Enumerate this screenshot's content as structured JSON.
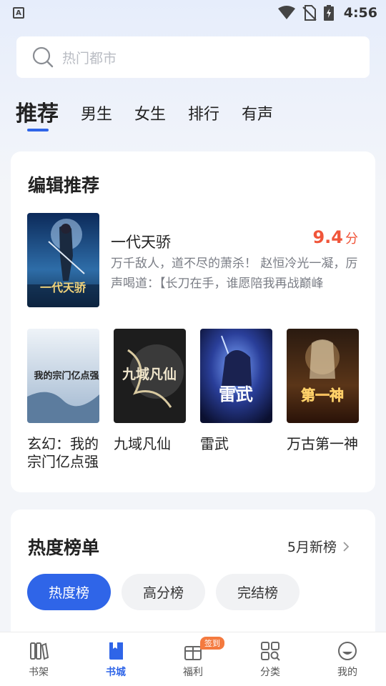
{
  "status_bar": {
    "time": "4:56",
    "left_icon": "A"
  },
  "search": {
    "placeholder": "热门都市"
  },
  "tabs": [
    {
      "label": "推荐",
      "active": true
    },
    {
      "label": "男生"
    },
    {
      "label": "女生"
    },
    {
      "label": "排行"
    },
    {
      "label": "有声"
    }
  ],
  "editor_pick": {
    "title": "编辑推荐",
    "featured": {
      "name": "一代天骄",
      "score": "9.4",
      "score_unit": "分",
      "description": "万千敌人，道不尽的萧杀！ 赵恒冷光一凝，厉声喝道：【长刀在手，谁愿陪我再战巅峰",
      "cover_text": "一代天骄"
    },
    "books": [
      {
        "name": "玄幻：我的宗门亿点强",
        "cover_text": "我的宗门亿点强"
      },
      {
        "name": "九域凡仙",
        "cover_text": "九域凡仙"
      },
      {
        "name": "雷武",
        "cover_text": "雷武"
      },
      {
        "name": "万古第一神",
        "cover_text": "第一神"
      }
    ]
  },
  "hot_list": {
    "title": "热度榜单",
    "more": "5月新榜",
    "chips": [
      {
        "label": "热度榜",
        "active": true
      },
      {
        "label": "高分榜"
      },
      {
        "label": "完结榜"
      }
    ]
  },
  "bottom_nav": {
    "items": [
      {
        "label": "书架",
        "icon": "bookshelf-icon"
      },
      {
        "label": "书城",
        "icon": "book-icon",
        "active": true
      },
      {
        "label": "福利",
        "icon": "gift-icon",
        "badge": "签到"
      },
      {
        "label": "分类",
        "icon": "category-icon"
      },
      {
        "label": "我的",
        "icon": "profile-icon"
      }
    ]
  },
  "colors": {
    "accent": "#2f65e8",
    "score": "#f0553a",
    "badge": "#f47a3f"
  }
}
